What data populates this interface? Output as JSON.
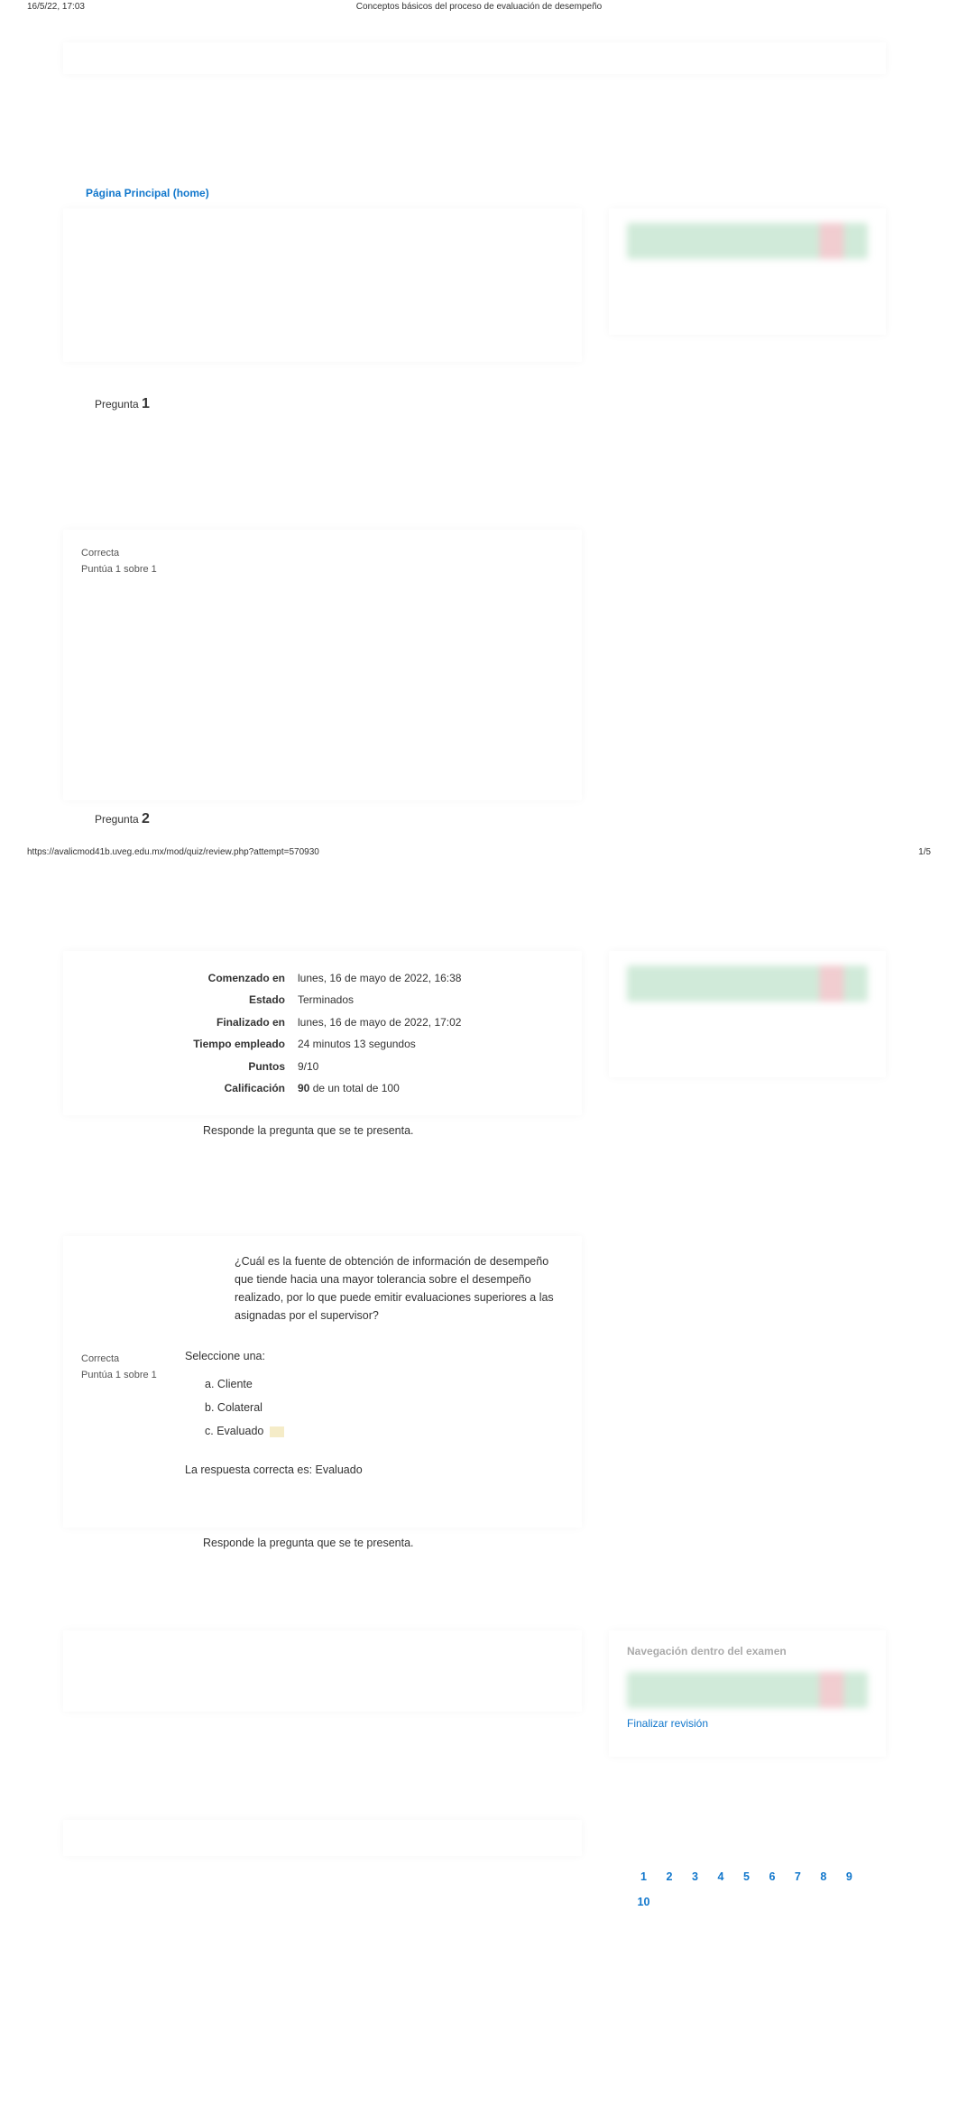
{
  "header": {
    "datetime": "16/5/22, 17:03",
    "title": "Conceptos básicos del proceso de evaluación de desempeño"
  },
  "footer": {
    "url": "https://avalicmod41b.uveg.edu.mx/mod/quiz/review.php?attempt=570930",
    "page": "1/5"
  },
  "breadcrumb": "Página Principal (home)",
  "summary": {
    "rows": [
      {
        "label": "Comenzado en",
        "value": "lunes, 16 de mayo de 2022, 16:38"
      },
      {
        "label": "Estado",
        "value": "Terminados"
      },
      {
        "label": "Finalizado en",
        "value": "lunes, 16 de mayo de 2022, 17:02"
      },
      {
        "label": "Tiempo empleado",
        "value": "24 minutos 13 segundos"
      },
      {
        "label": "Puntos",
        "value": "9/10"
      },
      {
        "label": "Calificación",
        "value_strong": "90",
        "value_rest": " de un total de 100"
      }
    ]
  },
  "questions": [
    {
      "label": "Pregunta",
      "number": "1",
      "status": "Correcta",
      "points": "Puntúa 1 sobre 1",
      "prompt": "Responde la pregunta que se te presenta.",
      "text": "¿Cuál es la fuente de obtención de información de desempeño que tiende hacia una mayor tolerancia sobre el desempeño realizado, por lo que puede emitir evaluaciones superiores a las asignadas por el supervisor?",
      "select_one": "Seleccione una:",
      "options": [
        {
          "letter": "a.",
          "text": "Cliente",
          "selected": false
        },
        {
          "letter": "b.",
          "text": "Colateral",
          "selected": false
        },
        {
          "letter": "c.",
          "text": "Evaluado",
          "selected": true
        }
      ],
      "feedback": "La respuesta correcta es: Evaluado",
      "next_prompt": "Responde la pregunta que se te presenta."
    },
    {
      "label": "Pregunta",
      "number": "2",
      "status": "Correcta",
      "points": "Puntúa 1 sobre 1"
    }
  ],
  "sidebar": {
    "nav_title": "Navegación dentro del examen",
    "finish": "Finalizar revisión",
    "numbers": [
      "1",
      "2",
      "3",
      "4",
      "5",
      "6",
      "7",
      "8",
      "9",
      "10"
    ]
  }
}
